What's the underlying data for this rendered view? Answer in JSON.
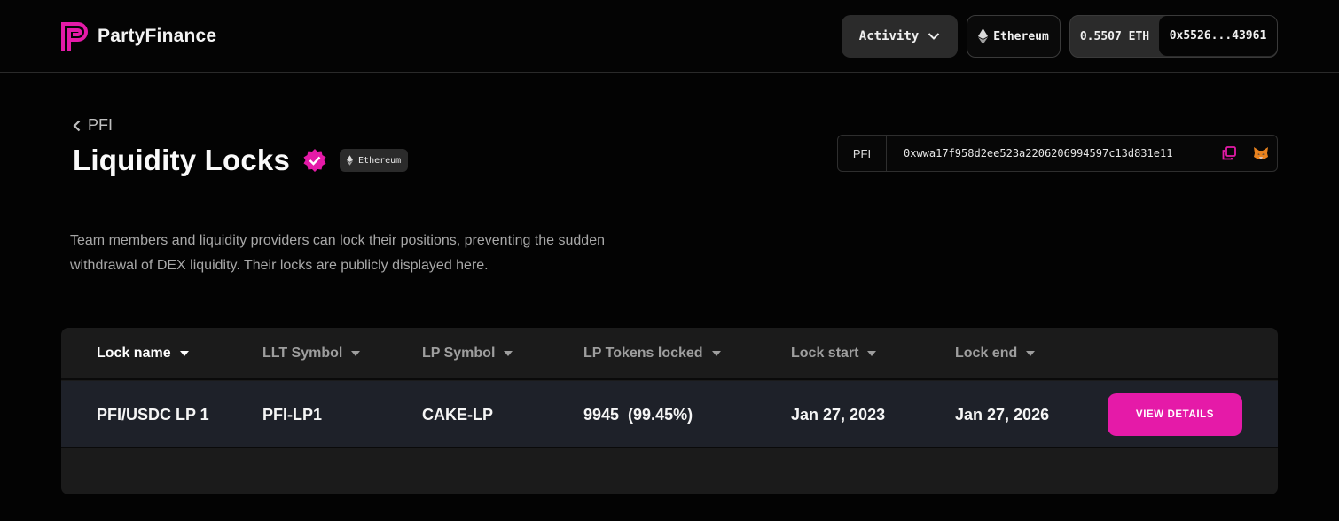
{
  "brand": {
    "name": "PartyFinance",
    "accent": "#e51aa8"
  },
  "header": {
    "activity_label": "Activity",
    "network_label": "Ethereum",
    "balance": "0.5507 ETH",
    "address": "0x5526...43961"
  },
  "page": {
    "back_label": "PFI",
    "title": "Liquidity Locks",
    "chain_badge": "Ethereum",
    "token_symbol": "PFI",
    "token_address": "0xwwa17f958d2ee523a2206206994597c13d831e11",
    "description": "Team members and liquidity providers can lock their positions, preventing the sudden withdrawal of DEX liquidity. Their locks are publicly displayed here."
  },
  "table": {
    "columns": [
      "Lock name",
      "LLT Symbol",
      "LP Symbol",
      "LP Tokens locked",
      "Lock start",
      "Lock end"
    ],
    "rows": [
      {
        "lock_name": "PFI/USDC LP 1",
        "llt_symbol": "PFI-LP1",
        "lp_symbol": "CAKE-LP",
        "lp_tokens_locked": "9945  (99.45%)",
        "lock_start": "Jan 27, 2023",
        "lock_end": "Jan 27, 2026",
        "action_label": "VIEW DETAILS"
      }
    ]
  }
}
